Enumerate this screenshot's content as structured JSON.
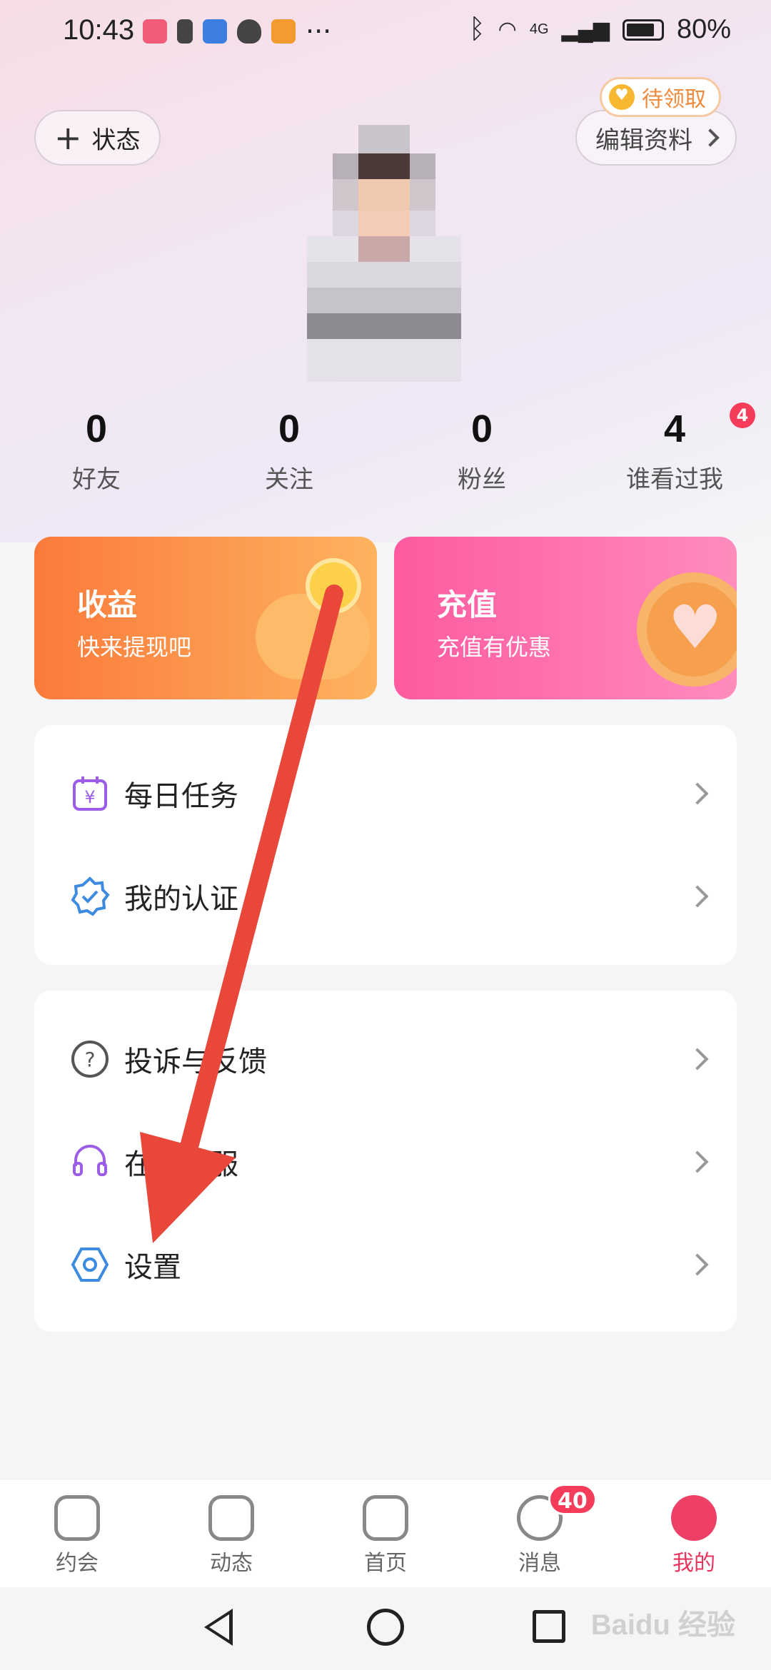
{
  "status_bar": {
    "time": "10:43",
    "more": "···",
    "network": "4G",
    "battery": "80%"
  },
  "header": {
    "status_button": "状态",
    "reward_badge": "待领取",
    "edit_profile": "编辑资料"
  },
  "stats": [
    {
      "value": "0",
      "label": "好友"
    },
    {
      "value": "0",
      "label": "关注"
    },
    {
      "value": "0",
      "label": "粉丝"
    },
    {
      "value": "4",
      "label": "谁看过我",
      "badge": "4"
    }
  ],
  "cards": {
    "earnings": {
      "title": "收益",
      "subtitle": "快来提现吧"
    },
    "recharge": {
      "title": "充值",
      "subtitle": "充值有优惠"
    }
  },
  "menu_group_1": [
    {
      "label": "每日任务",
      "icon": "calendar-yen-icon"
    },
    {
      "label": "我的认证",
      "icon": "verified-badge-icon"
    }
  ],
  "menu_group_2": [
    {
      "label": "投诉与反馈",
      "icon": "question-circle-icon"
    },
    {
      "label": "在线客服",
      "icon": "headset-icon"
    },
    {
      "label": "设置",
      "icon": "settings-hex-icon"
    }
  ],
  "tabs": [
    {
      "label": "约会",
      "icon": "tv-play-icon"
    },
    {
      "label": "动态",
      "icon": "compass-leaf-icon"
    },
    {
      "label": "首页",
      "icon": "home-smile-icon"
    },
    {
      "label": "消息",
      "icon": "chat-heart-icon",
      "badge": "40"
    },
    {
      "label": "我的",
      "icon": "profile-face-icon",
      "active": true
    }
  ],
  "watermark": "Baidu 经验",
  "colors": {
    "accent": "#e8345e",
    "earnings_card": "#fb7a3a",
    "recharge_card": "#fe5aa0",
    "badge": "#f53c5a",
    "arrow": "#e8473a"
  }
}
